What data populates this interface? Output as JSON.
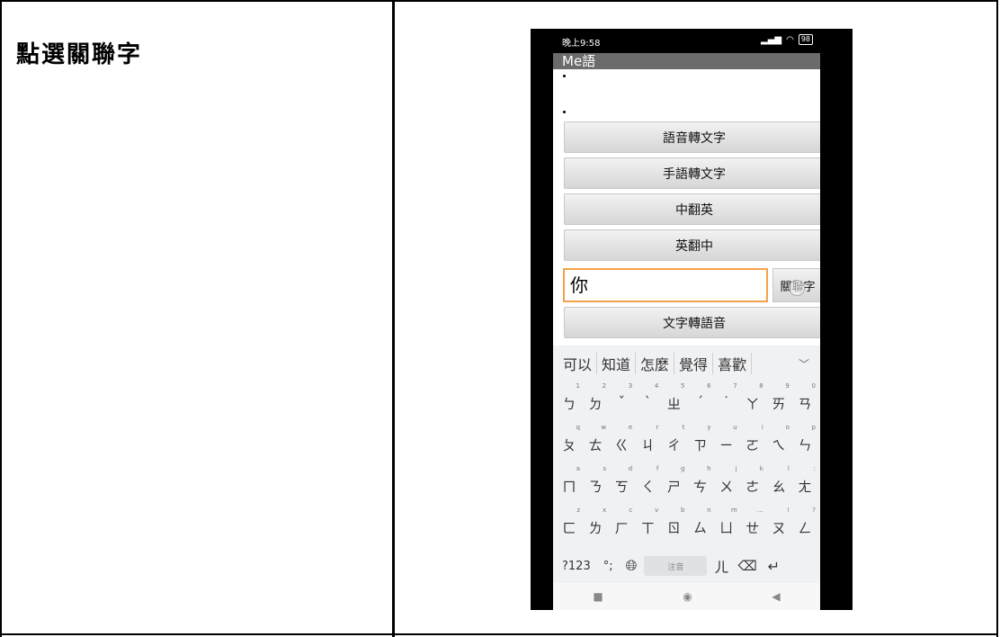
{
  "caption": "點選關聯字",
  "phone": {
    "status": {
      "time": "晚上9:58",
      "battery": "98"
    },
    "app_title": "Me語",
    "buttons": {
      "speech_to_text": "語音轉文字",
      "sign_to_text": "手語轉文字",
      "zh_to_en": "中翻英",
      "en_to_zh": "英翻中",
      "text_to_speech": "文字轉語音"
    },
    "input": {
      "value": "你"
    },
    "associate_button": "關聯字",
    "keyboard": {
      "suggestions": [
        "可以",
        "知道",
        "怎麼",
        "覺得",
        "喜歡"
      ],
      "rows": [
        {
          "keys": [
            "ㄅ",
            "ㄉ",
            "ˇ",
            "ˋ",
            "ㄓ",
            "ˊ",
            "˙",
            "ㄚ",
            "ㄞ",
            "ㄢ"
          ],
          "hints": [
            "1",
            "2",
            "3",
            "4",
            "5",
            "6",
            "7",
            "8",
            "9",
            "0"
          ]
        },
        {
          "keys": [
            "ㄆ",
            "ㄊ",
            "ㄍ",
            "ㄐ",
            "ㄔ",
            "ㄗ",
            "ㄧ",
            "ㄛ",
            "ㄟ",
            "ㄣ"
          ],
          "hints": [
            "q",
            "w",
            "e",
            "r",
            "t",
            "y",
            "u",
            "i",
            "o",
            "p"
          ]
        },
        {
          "keys": [
            "ㄇ",
            "ㄋ",
            "ㄎ",
            "ㄑ",
            "ㄕ",
            "ㄘ",
            "ㄨ",
            "ㄜ",
            "ㄠ",
            "ㄤ"
          ],
          "hints": [
            "a",
            "s",
            "d",
            "f",
            "g",
            "h",
            "j",
            "k",
            "l",
            ":"
          ]
        },
        {
          "keys": [
            "ㄈ",
            "ㄌ",
            "ㄏ",
            "ㄒ",
            "ㄖ",
            "ㄙ",
            "ㄩ",
            "ㄝ",
            "ㄡ",
            "ㄥ"
          ],
          "hints": [
            "z",
            "x",
            "c",
            "v",
            "b",
            "n",
            "m",
            "…",
            "!",
            "?"
          ]
        }
      ],
      "symbols_key": "?123",
      "punct_key": "°;",
      "space_label": "注音",
      "er_key": "ㄦ",
      "backspace": "⌫",
      "enter": "↵"
    },
    "nav": {
      "recents": "■",
      "home": "◉",
      "back": "◀"
    }
  }
}
